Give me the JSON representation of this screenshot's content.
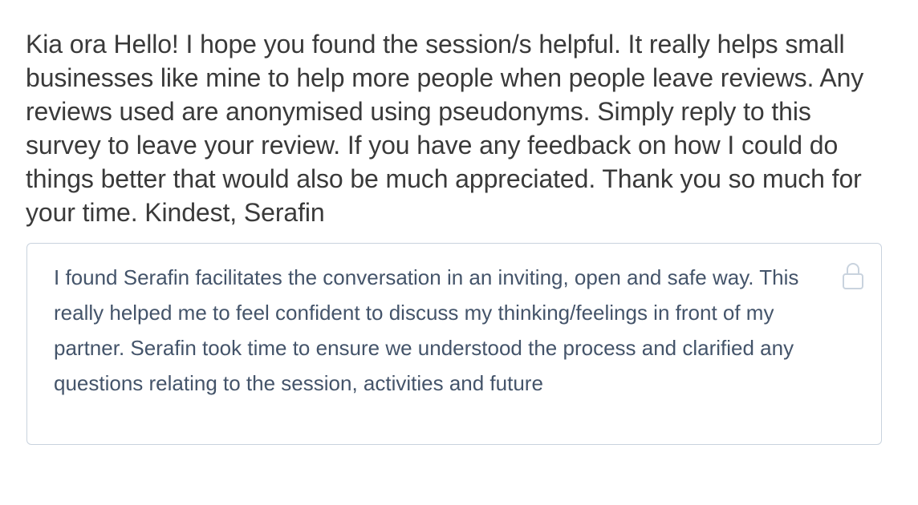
{
  "survey": {
    "question_text": "Kia ora Hello! I hope you found the session/s helpful. It really helps small businesses like mine to help more people when people leave reviews. Any reviews used are anonymised using pseudonyms. Simply reply to this survey to leave your review. If you have any feedback on how I could do things better that would also be much appreciated. Thank you so much for your time. Kindest, Serafin",
    "response": {
      "value": "I found Serafin facilitates the conversation in an inviting, open and safe way. This really helped me to feel confident to discuss my thinking/feelings in front of my partner. Serafin took time to ensure we understood the process and clarified any questions relating to the session, activities and future",
      "locked_icon": "lock-icon"
    }
  },
  "colors": {
    "question_text": "#3a3a3a",
    "response_text": "#44546a",
    "box_border": "#c9d3de",
    "lock_icon": "#c9d3de"
  }
}
